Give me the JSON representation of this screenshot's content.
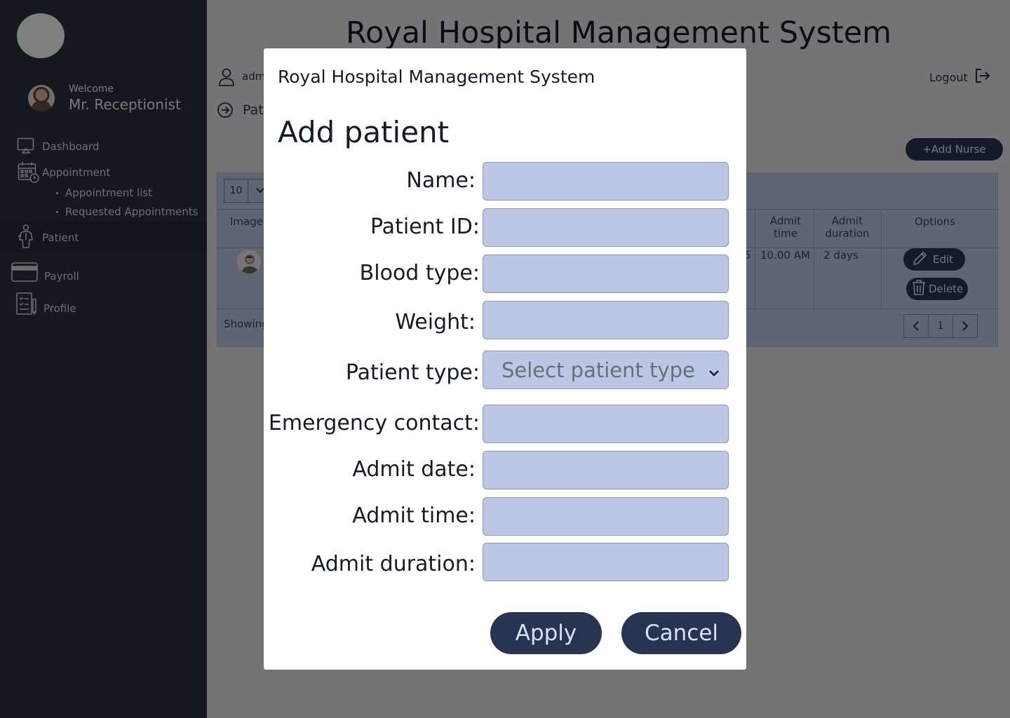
{
  "sidebar": {
    "welcome": "Welcome",
    "user_name": "Mr. Receptionist",
    "items": [
      {
        "label": "Dashboard",
        "icon": "monitor-icon"
      },
      {
        "label": "Appointment",
        "icon": "calendar-icon"
      },
      {
        "label": "Patient",
        "icon": "patient-icon"
      },
      {
        "label": "Payroll",
        "icon": "credit-card-icon"
      },
      {
        "label": "Profile",
        "icon": "clipboard-icon"
      }
    ],
    "sub_items": [
      "Appointment list",
      "Requested Appointments"
    ]
  },
  "header": {
    "title": "Royal Hospital Management System",
    "admin": "adm",
    "logout": "Logout",
    "breadcrumb": "Pat"
  },
  "toolbar": {
    "add_nurse": "+Add Nurse",
    "page_length": "10"
  },
  "table": {
    "headers": {
      "image": "Image",
      "admit_time": "Admit time",
      "admit_duration": "Admit duration",
      "options": "Options"
    },
    "row": {
      "partial": "5",
      "admit_time": "10.00 AM",
      "admit_duration": "2 days",
      "edit": "Edit",
      "delete": "Delete"
    },
    "showing": "Showing",
    "page": "1"
  },
  "modal": {
    "system_name": "Royal Hospital Management System",
    "title": "Add patient",
    "fields": {
      "name": "Name:",
      "patient_id": "Patient ID:",
      "blood_type": "Blood type:",
      "weight": "Weight:",
      "patient_type": "Patient type:",
      "patient_type_placeholder": "Select patient type",
      "emergency_contact": "Emergency contact:",
      "admit_date": "Admit date:",
      "admit_time": "Admit time:",
      "admit_duration": "Admit duration:"
    },
    "apply": "Apply",
    "cancel": "Cancel"
  },
  "colors": {
    "sidebar_bg": "#2b323e",
    "accent": "#283552",
    "input_bg": "#bcc7e6",
    "panel_bg": "#c0cbe6"
  }
}
